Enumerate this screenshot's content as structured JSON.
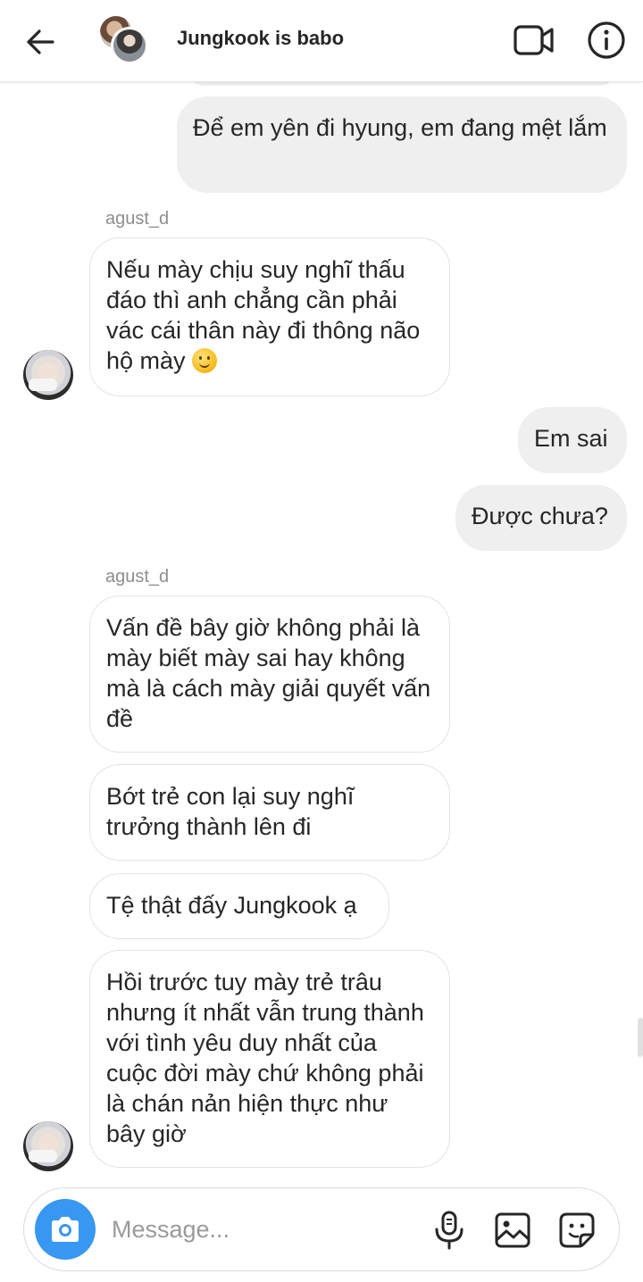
{
  "header": {
    "title": "Jungkook is babo",
    "back_icon": "arrow-left-icon",
    "video_icon": "video-camera-icon",
    "info_icon": "info-icon"
  },
  "messages": [
    {
      "direction": "out",
      "text": "Để em yên đi hyung, em đang mệt lắm"
    },
    {
      "direction": "in",
      "sender": "agust_d",
      "text": "Nếu mày chịu suy nghĩ thấu đáo thì anh chẳng cần phải vác cái thân này đi thông não hộ mày",
      "emoji": "slightly-smiling-face"
    },
    {
      "direction": "out",
      "text": "Em sai"
    },
    {
      "direction": "out",
      "text": "Được chưa?"
    },
    {
      "direction": "in",
      "sender": "agust_d",
      "text": "Vấn đề bây giờ không phải là mày biết mày sai hay không mà là cách mày giải quyết vấn đề"
    },
    {
      "direction": "in",
      "text": "Bớt trẻ con lại suy nghĩ trưởng thành lên đi"
    },
    {
      "direction": "in",
      "text": "Tệ thật đấy Jungkook ạ"
    },
    {
      "direction": "in",
      "text": "Hồi trước tuy mày trẻ trâu nhưng ít nhất vẫn trung thành với tình yêu duy nhất của cuộc đời mày chứ không phải  là chán nản hiện thực như bây giờ"
    }
  ],
  "composer": {
    "placeholder": "Message...",
    "camera_icon": "camera-icon",
    "mic_icon": "microphone-icon",
    "gallery_icon": "image-icon",
    "sticker_icon": "sticker-icon"
  },
  "colors": {
    "accent": "#3897f0",
    "outgoing_bubble": "#efefef",
    "incoming_border": "#e2e2e2",
    "sender_text": "#8e8e8e"
  }
}
